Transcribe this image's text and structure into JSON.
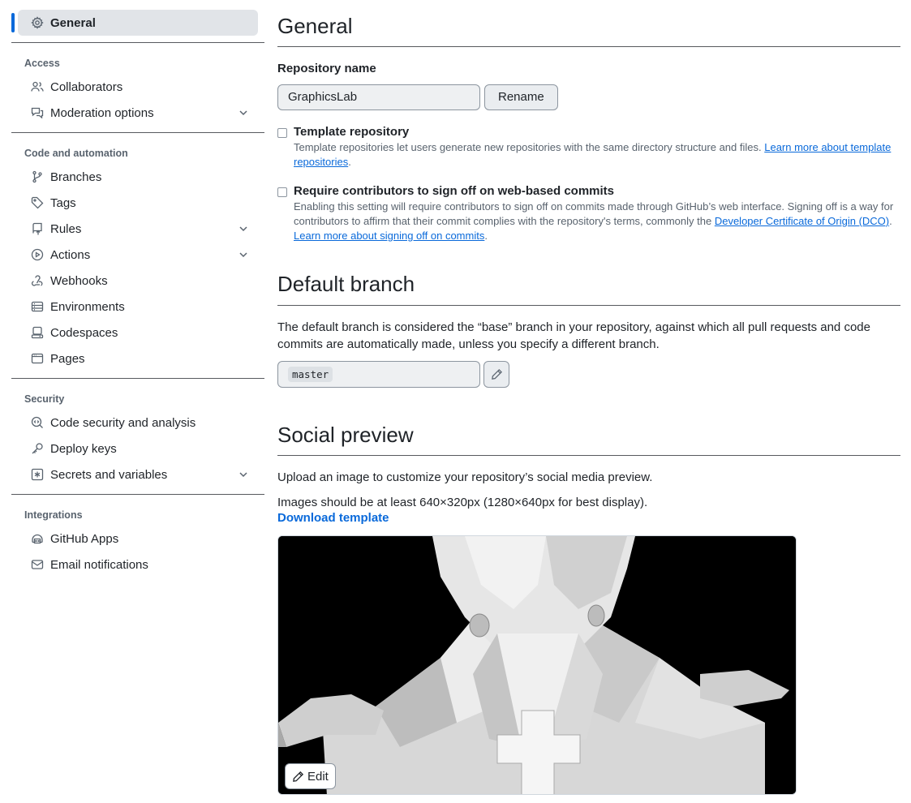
{
  "sidebar": {
    "top_items": [
      {
        "label": "General",
        "icon": "gear-icon",
        "active": true
      }
    ],
    "groups": [
      {
        "title": "Access",
        "items": [
          {
            "label": "Collaborators",
            "icon": "people-icon"
          },
          {
            "label": "Moderation options",
            "icon": "comment-discussion-icon",
            "expandable": true
          }
        ]
      },
      {
        "title": "Code and automation",
        "items": [
          {
            "label": "Branches",
            "icon": "git-branch-icon"
          },
          {
            "label": "Tags",
            "icon": "tag-icon"
          },
          {
            "label": "Rules",
            "icon": "repo-push-icon",
            "expandable": true
          },
          {
            "label": "Actions",
            "icon": "play-icon",
            "expandable": true
          },
          {
            "label": "Webhooks",
            "icon": "webhook-icon"
          },
          {
            "label": "Environments",
            "icon": "server-icon"
          },
          {
            "label": "Codespaces",
            "icon": "codespaces-icon"
          },
          {
            "label": "Pages",
            "icon": "browser-icon"
          }
        ]
      },
      {
        "title": "Security",
        "items": [
          {
            "label": "Code security and analysis",
            "icon": "codescan-icon"
          },
          {
            "label": "Deploy keys",
            "icon": "key-icon"
          },
          {
            "label": "Secrets and variables",
            "icon": "key-asterisk-icon",
            "expandable": true
          }
        ]
      },
      {
        "title": "Integrations",
        "items": [
          {
            "label": "GitHub Apps",
            "icon": "apps-icon"
          },
          {
            "label": "Email notifications",
            "icon": "mail-icon"
          }
        ]
      }
    ]
  },
  "general": {
    "title": "General",
    "repo_name_label": "Repository name",
    "repo_name_value": "GraphicsLab",
    "rename_label": "Rename",
    "template_title": "Template repository",
    "template_desc": "Template repositories let users generate new repositories with the same directory structure and files.",
    "template_link": "Learn more about template repositories",
    "signoff_title": "Require contributors to sign off on web-based commits",
    "signoff_desc": "Enabling this setting will require contributors to sign off on commits made through GitHub’s web interface. Signing off is a way for contributors to affirm that their commit complies with the repository's terms, commonly the",
    "signoff_dco_link": "Developer Certificate of Origin (DCO)",
    "signoff_learn_link": "Learn more about signing off on commits"
  },
  "default_branch": {
    "title": "Default branch",
    "desc": "The default branch is considered the “base” branch in your repository, against which all pull requests and code commits are automatically made, unless you specify a different branch.",
    "branch": "master"
  },
  "social_preview": {
    "title": "Social preview",
    "desc1": "Upload an image to customize your repository’s social media preview.",
    "desc2": "Images should be at least 640×320px (1280×640px for best display).",
    "download_label": "Download template",
    "edit_label": "Edit"
  },
  "colors": {
    "accent": "#0969da",
    "active_bg": "#e1e4e8",
    "muted_text": "#59636e"
  }
}
